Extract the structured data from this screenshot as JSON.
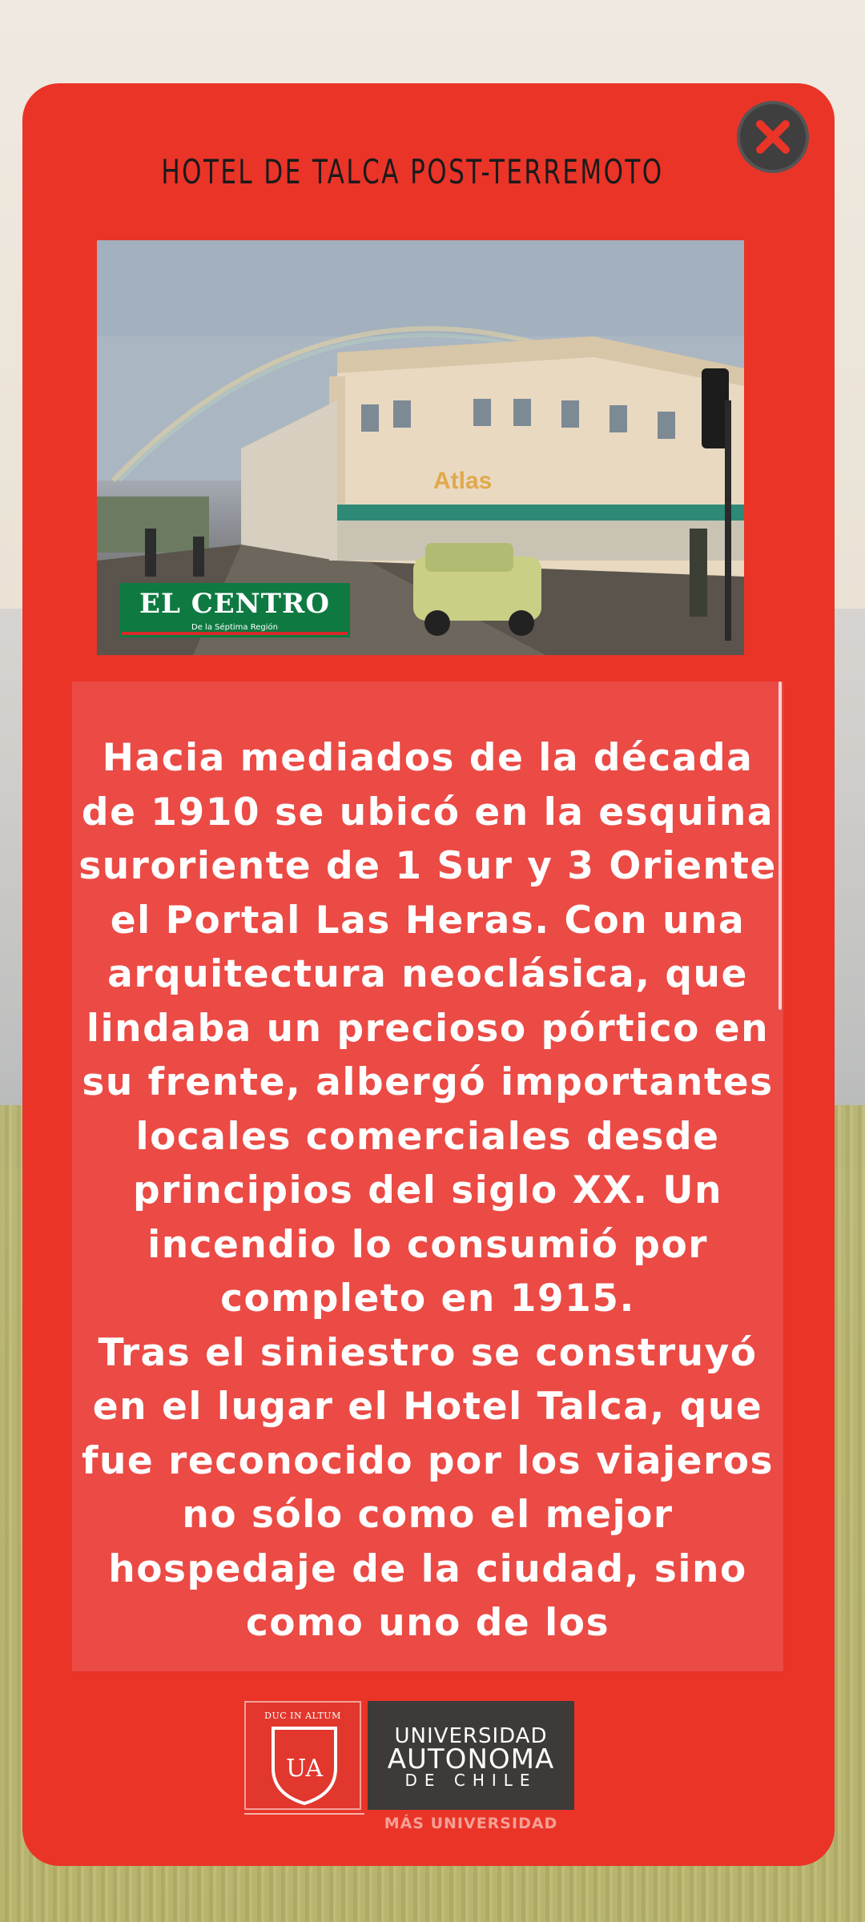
{
  "modal": {
    "title": "HOTEL DE TALCA  POST-TERREMOTO",
    "close_icon": "close-icon"
  },
  "photo": {
    "logo_text": "EL CENTRO",
    "logo_subtext": "De la Séptima Región"
  },
  "body_text": "Hacia mediados de la década de 1910 se ubicó en la esquina suroriente de 1 Sur y 3 Oriente el Portal Las Heras. Con una arquitectura neoclásica, que lindaba un precioso pórtico en su frente, albergó importantes locales comerciales desde principios del siglo XX. Un incendio lo consumió por completo en 1915.\nTras el siniestro se construyó en el lugar el Hotel Talca, que fue reconocido por los viajeros no sólo como el mejor hospedaje de la ciudad, sino como uno de los",
  "university_logo": {
    "motto": "DUC IN ALTUM",
    "initials": "UA",
    "name_line1": "UNIVERSIDAD",
    "name_line2": "AUTONOMA",
    "name_line3": "DE CHILE",
    "tagline": "MÁS UNIVERSIDAD"
  },
  "colors": {
    "card": "#ea3428",
    "text_panel": "#eb4a45",
    "close_button": "#3f3f3f"
  }
}
